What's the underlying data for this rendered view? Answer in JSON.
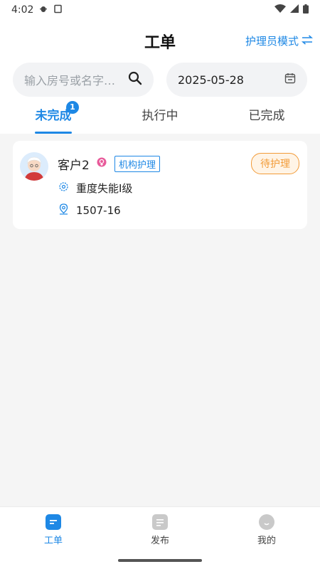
{
  "status_bar": {
    "time": "4:02"
  },
  "header": {
    "title": "工单",
    "mode_label": "护理员模式",
    "mode_icon": "swap-icon"
  },
  "search": {
    "placeholder": "输入房号或名字…",
    "icon": "search-icon"
  },
  "date_picker": {
    "value": "2025-05-28",
    "icon": "calendar-icon"
  },
  "tabs": [
    {
      "label": "未完成",
      "badge": "1",
      "active": true
    },
    {
      "label": "执行中",
      "active": false
    },
    {
      "label": "已完成",
      "active": false
    }
  ],
  "orders": [
    {
      "name": "客户2",
      "gender_icon": "female-icon",
      "tag": "机构护理",
      "status": "待护理",
      "care_level": "重度失能I级",
      "room": "1507-16"
    }
  ],
  "bottom_nav": [
    {
      "label": "工单",
      "active": true
    },
    {
      "label": "发布",
      "active": false
    },
    {
      "label": "我的",
      "active": false
    }
  ],
  "colors": {
    "accent": "#1e88e5",
    "pending": "#f29b38",
    "female": "#e85a9a"
  }
}
